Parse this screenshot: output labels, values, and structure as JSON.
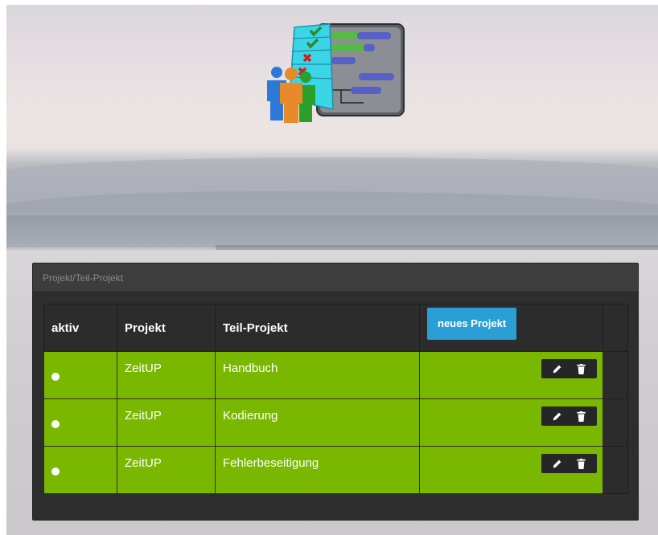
{
  "panel": {
    "title": "Projekt/Teil-Projekt"
  },
  "table": {
    "headers": {
      "active": "aktiv",
      "project": "Projekt",
      "subproject": "Teil-Projekt"
    },
    "new_button_label": "neues Projekt",
    "rows": [
      {
        "project": "ZeitUP",
        "subproject": "Handbuch"
      },
      {
        "project": "ZeitUP",
        "subproject": "Kodierung"
      },
      {
        "project": "ZeitUP",
        "subproject": "Fehlerbeseitigung"
      }
    ]
  },
  "colors": {
    "row_green": "#7ab800",
    "button_blue": "#2a9fd6",
    "panel_dark": "#2e2e2e"
  },
  "icons": {
    "logo": "project-planning-logo",
    "edit": "pencil-icon",
    "delete": "trash-icon"
  }
}
